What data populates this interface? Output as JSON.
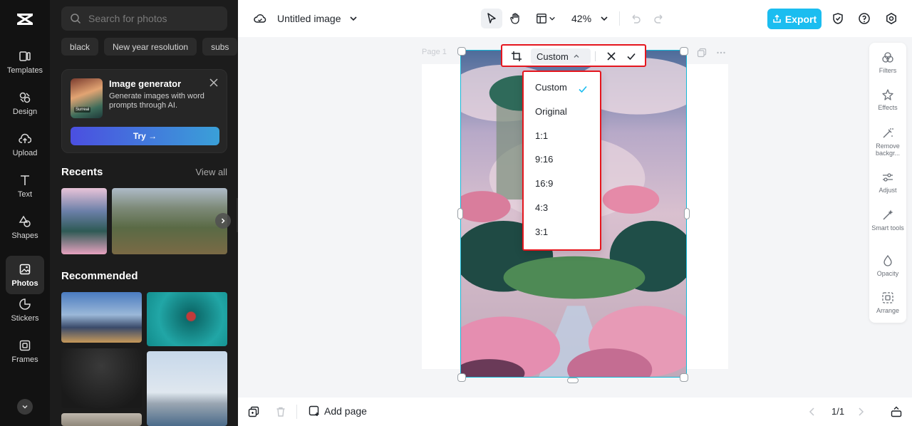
{
  "rail": {
    "items": [
      {
        "label": "Templates",
        "icon": "templates-icon"
      },
      {
        "label": "Design",
        "icon": "design-icon"
      },
      {
        "label": "Upload",
        "icon": "upload-icon"
      },
      {
        "label": "Text",
        "icon": "text-icon"
      },
      {
        "label": "Shapes",
        "icon": "shapes-icon"
      },
      {
        "label": "Photos",
        "icon": "photos-icon",
        "active": true
      },
      {
        "label": "Stickers",
        "icon": "stickers-icon"
      },
      {
        "label": "Frames",
        "icon": "frames-icon"
      }
    ]
  },
  "panel": {
    "search_placeholder": "Search for photos",
    "chips": [
      "black",
      "New year resolution",
      "subs"
    ],
    "promo": {
      "title": "Image generator",
      "description": "Generate images with word prompts through AI.",
      "thumb_label": "Surreal",
      "button": "Try →"
    },
    "recents_title": "Recents",
    "view_all": "View all",
    "recommended_title": "Recommended"
  },
  "topbar": {
    "doc_title": "Untitled image",
    "zoom": "42%",
    "export_label": "Export"
  },
  "canvas": {
    "page_label": "Page 1"
  },
  "crop": {
    "selected_ratio": "Custom",
    "options": [
      "Custom",
      "Original",
      "1:1",
      "9:16",
      "16:9",
      "4:3",
      "3:1"
    ]
  },
  "right_sidebar": {
    "items": [
      "Filters",
      "Effects",
      "Remove backgr...",
      "Adjust",
      "Smart tools",
      "Opacity",
      "Arrange"
    ]
  },
  "bottombar": {
    "add_page": "Add page",
    "pager": "1/1"
  },
  "colors": {
    "accent": "#1bbdf0",
    "highlight_box": "#e5161e",
    "selection": "#14b8d6"
  }
}
